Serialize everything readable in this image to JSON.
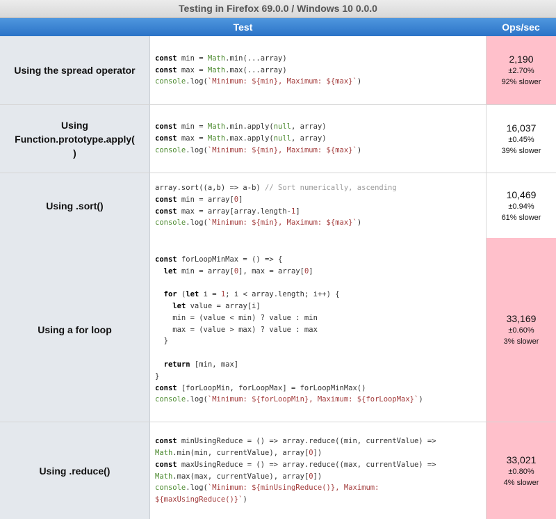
{
  "header": {
    "title": "Testing in Firefox 69.0.0 / Windows 10 0.0.0"
  },
  "table": {
    "col_test": "Test",
    "col_ops": "Ops/sec"
  },
  "colors": {
    "slow_highlight": "#ffc0cb",
    "header_blue": "#2b73c7",
    "label_bg": "#e4e8ed"
  },
  "rows": [
    {
      "name": "Using the spread operator",
      "code": [
        "const min = Math.min(...array)",
        "const max = Math.max(...array)",
        "console.log(`Minimum: ${min}, Maximum: ${max}`)"
      ],
      "ops": "2,190",
      "error": "±2.70%",
      "speed": "92% slower"
    },
    {
      "name": "Using Function.prototype.apply( )",
      "code": [
        "const min = Math.min.apply(null, array)",
        "const max = Math.max.apply(null, array)",
        "console.log(`Minimum: ${min}, Maximum: ${max}`)"
      ],
      "ops": "16,037",
      "error": "±0.45%",
      "speed": "39% slower"
    },
    {
      "name": "Using .sort()",
      "code": [
        "array.sort((a,b) => a-b) // Sort numerically, ascending",
        "const min = array[0]",
        "const max = array[array.length-1]",
        "console.log(`Minimum: ${min}, Maximum: ${max}`)"
      ],
      "ops": "10,469",
      "error": "±0.94%",
      "speed": "61% slower"
    },
    {
      "name": "Using a for loop",
      "code": [
        "const forLoopMinMax = () => {",
        "  let min = array[0], max = array[0]",
        "",
        "  for (let i = 1; i < array.length; i++) {",
        "    let value = array[i]",
        "    min = (value < min) ? value : min",
        "    max = (value > max) ? value : max",
        "  }",
        "",
        "  return [min, max]",
        "}",
        "const [forLoopMin, forLoopMax] = forLoopMinMax()",
        "console.log(`Minimum: ${forLoopMin}, Maximum: ${forLoopMax}`)"
      ],
      "ops": "33,169",
      "error": "±0.60%",
      "speed": "3% slower"
    },
    {
      "name": "Using .reduce()",
      "code": [
        "const minUsingReduce = () => array.reduce((min, currentValue) =>",
        "Math.min(min, currentValue), array[0])",
        "const maxUsingReduce = () => array.reduce((max, currentValue) =>",
        "Math.max(max, currentValue), array[0])",
        "console.log(`Minimum: ${minUsingReduce()}, Maximum:",
        "${maxUsingReduce()}`)"
      ],
      "ops": "33,021",
      "error": "±0.80%",
      "speed": "4% slower"
    }
  ]
}
